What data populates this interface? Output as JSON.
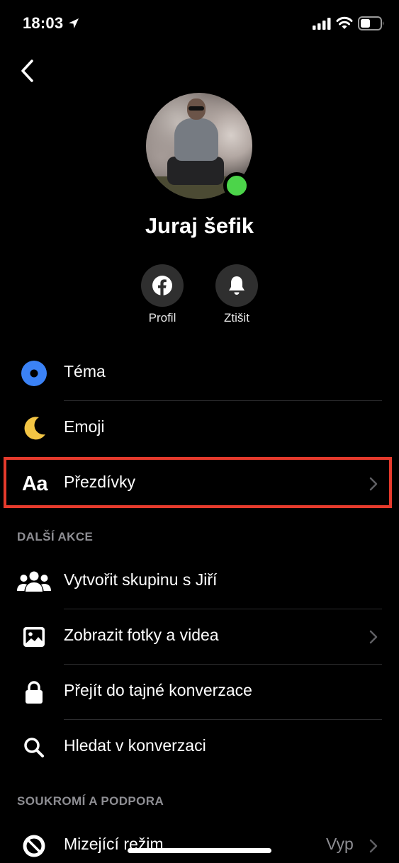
{
  "status_bar": {
    "time": "18:03"
  },
  "profile": {
    "name": "Juraj šefik"
  },
  "actions": [
    {
      "label": "Profil",
      "icon": "facebook-icon"
    },
    {
      "label": "Ztišit",
      "icon": "bell-icon"
    }
  ],
  "customize": [
    {
      "label": "Téma",
      "icon": "theme-dot-icon"
    },
    {
      "label": "Emoji",
      "icon": "moon-emoji-icon"
    },
    {
      "label": "Přezdívky",
      "icon": "text-aa-icon"
    }
  ],
  "sections": {
    "more_actions": "DALŠÍ AKCE",
    "privacy": "SOUKROMÍ A PODPORA"
  },
  "more_actions": [
    {
      "label": "Vytvořit skupinu s Jiří",
      "icon": "people-icon"
    },
    {
      "label": "Zobrazit fotky a videa",
      "icon": "photo-icon"
    },
    {
      "label": "Přejít do tajné konverzace",
      "icon": "lock-icon"
    },
    {
      "label": "Hledat v konverzaci",
      "icon": "search-icon"
    }
  ],
  "privacy": [
    {
      "label": "Mizející režim",
      "value": "Vyp",
      "icon": "vanish-mode-icon"
    }
  ],
  "colors": {
    "accent": "#3b82f6",
    "online": "#4cd44a",
    "highlight": "#e53a2c"
  }
}
